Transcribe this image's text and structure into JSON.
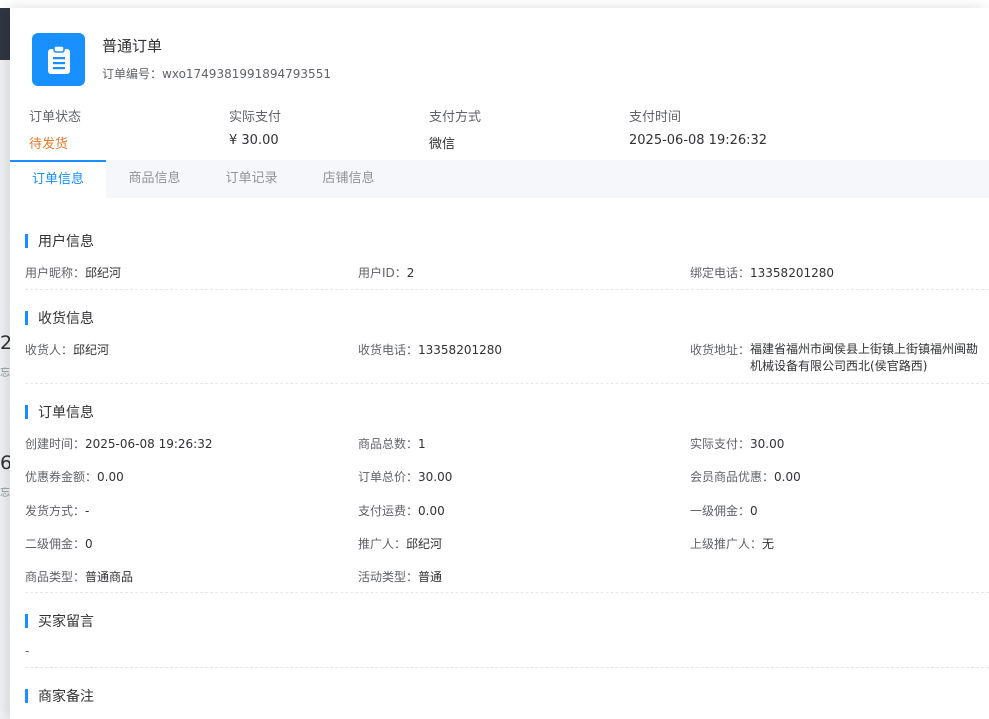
{
  "background": {
    "numbers": [
      "2",
      "6"
    ],
    "subs": [
      "忘",
      "忘"
    ]
  },
  "header": {
    "title": "普通订单",
    "order_no_label": "订单编号：",
    "order_no": "wxo1749381991894793551",
    "icon": "clipboard-icon"
  },
  "summary": [
    {
      "label": "订单状态",
      "value": "待发货"
    },
    {
      "label": "实际支付",
      "value": "¥ 30.00"
    },
    {
      "label": "支付方式",
      "value": "微信"
    },
    {
      "label": "支付时间",
      "value": "2025-06-08 19:26:32"
    }
  ],
  "tabs": [
    "订单信息",
    "商品信息",
    "订单记录",
    "店铺信息"
  ],
  "sections": {
    "user": {
      "title": "用户信息",
      "fields": [
        {
          "label": "用户昵称：",
          "value": "邱纪河"
        },
        {
          "label": "用户ID：",
          "value": "2"
        },
        {
          "label": "绑定电话：",
          "value": "13358201280"
        }
      ]
    },
    "shipping": {
      "title": "收货信息",
      "fields": [
        {
          "label": "收货人：",
          "value": "邱纪河"
        },
        {
          "label": "收货电话：",
          "value": "13358201280"
        },
        {
          "label": "收货地址：",
          "value": "福建省福州市闽侯县上街镇上街镇福州闽勘机械设备有限公司西北(侯官路西)"
        }
      ]
    },
    "order": {
      "title": "订单信息",
      "fields": [
        {
          "label": "创建时间：",
          "value": "2025-06-08 19:26:32"
        },
        {
          "label": "商品总数：",
          "value": "1"
        },
        {
          "label": "实际支付：",
          "value": "30.00"
        },
        {
          "label": "优惠券金额：",
          "value": "0.00"
        },
        {
          "label": "订单总价：",
          "value": "30.00"
        },
        {
          "label": "会员商品优惠：",
          "value": "0.00"
        },
        {
          "label": "发货方式：",
          "value": "-"
        },
        {
          "label": "支付运费：",
          "value": "0.00"
        },
        {
          "label": "一级佣金：",
          "value": "0"
        },
        {
          "label": "二级佣金：",
          "value": "0"
        },
        {
          "label": "推广人：",
          "value": "邱纪河"
        },
        {
          "label": "上级推广人：",
          "value": "无"
        },
        {
          "label": "商品类型：",
          "value": "普通商品"
        },
        {
          "label": "活动类型：",
          "value": "普通"
        }
      ]
    },
    "buyer_note": {
      "title": "买家留言",
      "value": "-"
    },
    "merchant_note": {
      "title": "商家备注"
    }
  },
  "colors": {
    "accent": "#1890ff",
    "status": "#e6792f"
  }
}
